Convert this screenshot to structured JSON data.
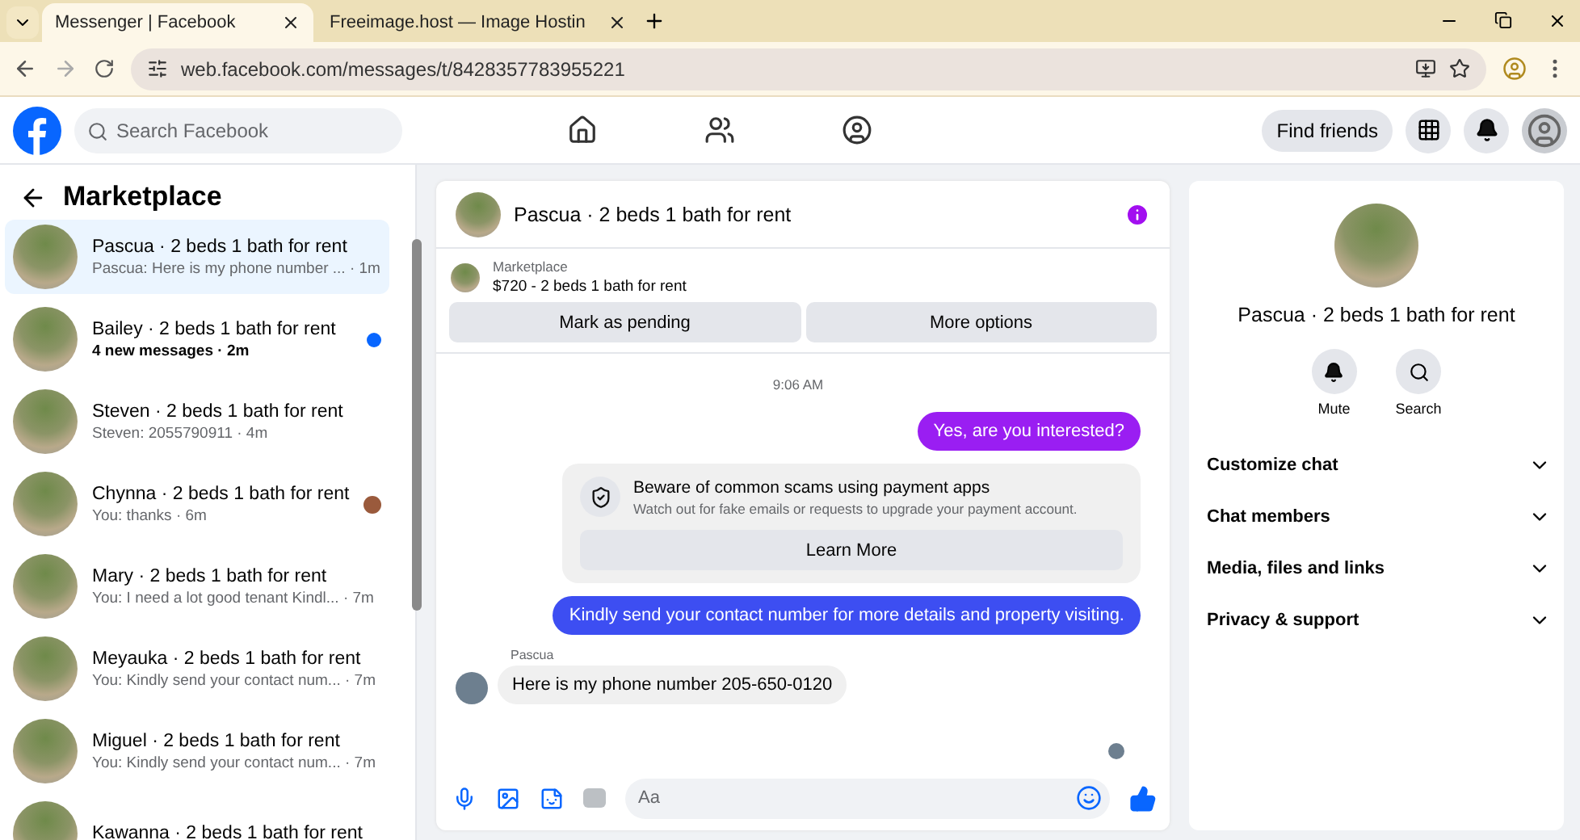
{
  "browser": {
    "tabs": [
      {
        "title": "Messenger | Facebook",
        "selected": true
      },
      {
        "title": "Freeimage.host — Image Hostin",
        "selected": false
      }
    ],
    "url": "web.facebook.com/messages/t/8428357783955221"
  },
  "header": {
    "search": {
      "placeholder": "Search Facebook"
    },
    "find_friends": "Find friends"
  },
  "sidebar": {
    "title": "Marketplace",
    "conversations": [
      {
        "name": "Pascua · 2 beds 1 bath for rent",
        "preview": "Pascua: Here is my phone number ...",
        "time": "· 1m",
        "selected": true,
        "unread": false,
        "seen": false
      },
      {
        "name": "Bailey · 2 beds 1 bath for rent",
        "preview": "4 new messages",
        "time": "· 2m",
        "selected": false,
        "unread": true,
        "seen": false
      },
      {
        "name": "Steven · 2 beds 1 bath for rent",
        "preview": "Steven: 2055790911",
        "time": "· 4m",
        "selected": false,
        "unread": false,
        "seen": false
      },
      {
        "name": "Chynna · 2 beds 1 bath for rent",
        "preview": "You: thanks",
        "time": "· 6m",
        "selected": false,
        "unread": false,
        "seen": true
      },
      {
        "name": "Mary · 2 beds 1 bath for rent",
        "preview": "You: I need a lot good tenant Kindl...",
        "time": "· 7m",
        "selected": false,
        "unread": false,
        "seen": false
      },
      {
        "name": "Meyauka · 2 beds 1 bath for rent",
        "preview": "You: Kindly send your contact num...",
        "time": "· 7m",
        "selected": false,
        "unread": false,
        "seen": false
      },
      {
        "name": "Miguel · 2 beds 1 bath for rent",
        "preview": "You: Kindly send your contact num...",
        "time": "· 7m",
        "selected": false,
        "unread": false,
        "seen": false
      },
      {
        "name": "Kawanna · 2 beds 1 bath for rent",
        "selected": false,
        "unread": false,
        "seen": false
      }
    ]
  },
  "chat": {
    "title": "Pascua · 2 beds 1 bath for rent",
    "listing": {
      "source": "Marketplace",
      "title": "$720 - 2 beds 1 bath for rent"
    },
    "actions": [
      "Mark as pending",
      "More options"
    ],
    "messages": [
      {
        "kind": "timestamp",
        "text": "9:06 AM"
      },
      {
        "kind": "outgoing",
        "text": "Yes, are you interested?",
        "color": "#9a1ef2"
      },
      {
        "kind": "notice",
        "title": "Beware of common scams using payment apps",
        "text": "Watch out for fake emails or requests to upgrade your payment account.",
        "button": "Learn More"
      },
      {
        "kind": "outgoing",
        "text": "Kindly send your contact number for more details and property visiting.",
        "color": "#3d4ef2"
      },
      {
        "kind": "incoming",
        "sender": "Pascua",
        "text": "Here is my phone number 205-650-0120"
      }
    ],
    "composer": {
      "placeholder": "Aa"
    }
  },
  "details": {
    "title": "Pascua · 2 beds 1 bath for rent",
    "actions": [
      "Mute",
      "Search"
    ],
    "sections": [
      {
        "label": "Customize chat",
        "expanded": false
      },
      {
        "label": "Chat members",
        "expanded": false
      },
      {
        "label": "Media, files and links",
        "expanded": false
      },
      {
        "label": "Privacy & support",
        "expanded": false
      }
    ]
  }
}
